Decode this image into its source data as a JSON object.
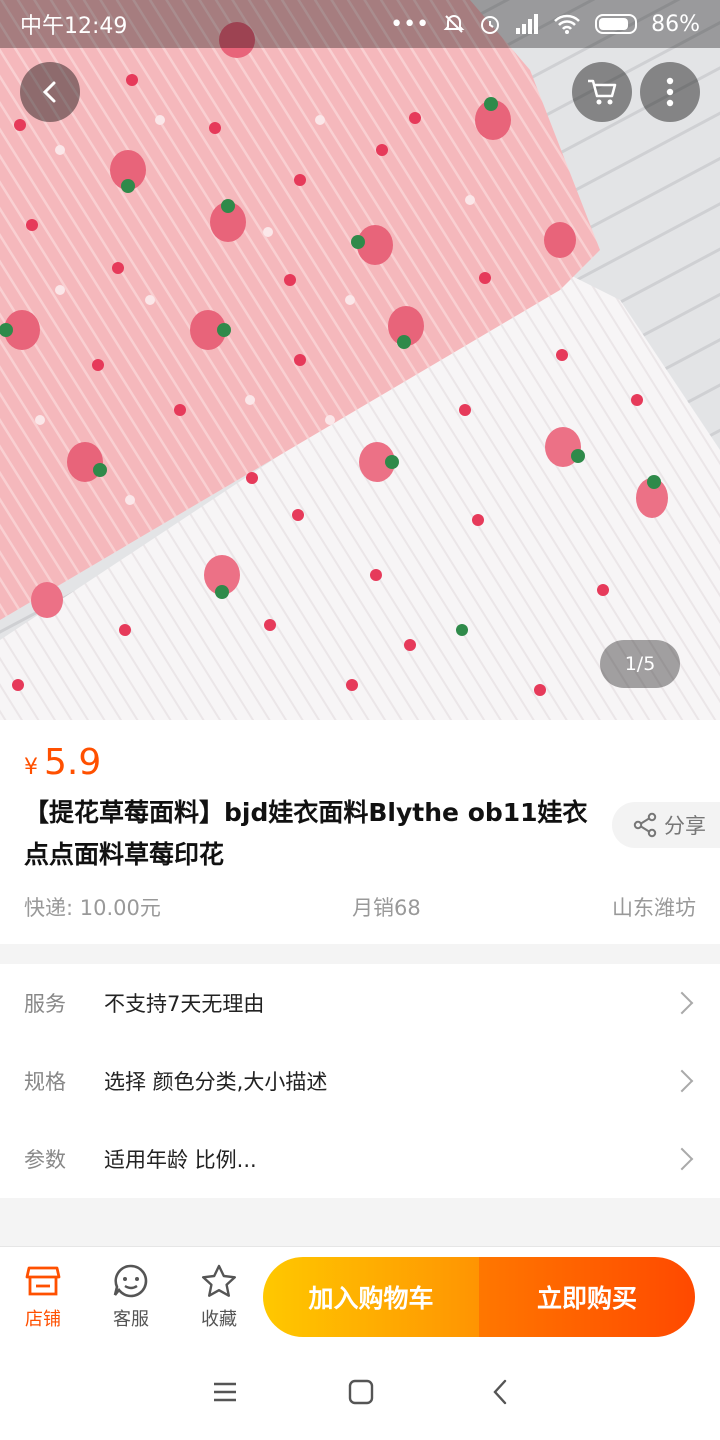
{
  "status_bar": {
    "time": "中午12:49",
    "dots": "•••",
    "battery": "86%"
  },
  "gallery": {
    "page_indicator": "1/5"
  },
  "product": {
    "currency": "¥",
    "price": "5.9",
    "title": "【提花草莓面料】bjd娃衣面料Blythe ob11娃衣点点面料草莓印花",
    "share_label": "分享",
    "shipping": "快递: 10.00元",
    "monthly_sales": "月销68",
    "location": "山东潍坊"
  },
  "specs": [
    {
      "key": "服务",
      "value": "不支持7天无理由"
    },
    {
      "key": "规格",
      "value": "选择 颜色分类,大小描述"
    },
    {
      "key": "参数",
      "value": "适用年龄 比例..."
    }
  ],
  "actions": {
    "shop": "店铺",
    "service": "客服",
    "favorite": "收藏",
    "add_to_cart": "加入购物车",
    "buy_now": "立即购买"
  },
  "colors": {
    "accent": "#ff5000",
    "cart_gradient": [
      "#ffc800",
      "#ff9402"
    ],
    "buy_gradient": [
      "#ff7700",
      "#ff4900"
    ]
  },
  "icons": [
    "back-arrow-icon",
    "cart-icon",
    "more-vertical-icon",
    "share-icon",
    "chevron-right-icon",
    "shop-icon",
    "customer-service-icon",
    "star-icon",
    "menu-icon",
    "home-icon",
    "back-icon"
  ]
}
